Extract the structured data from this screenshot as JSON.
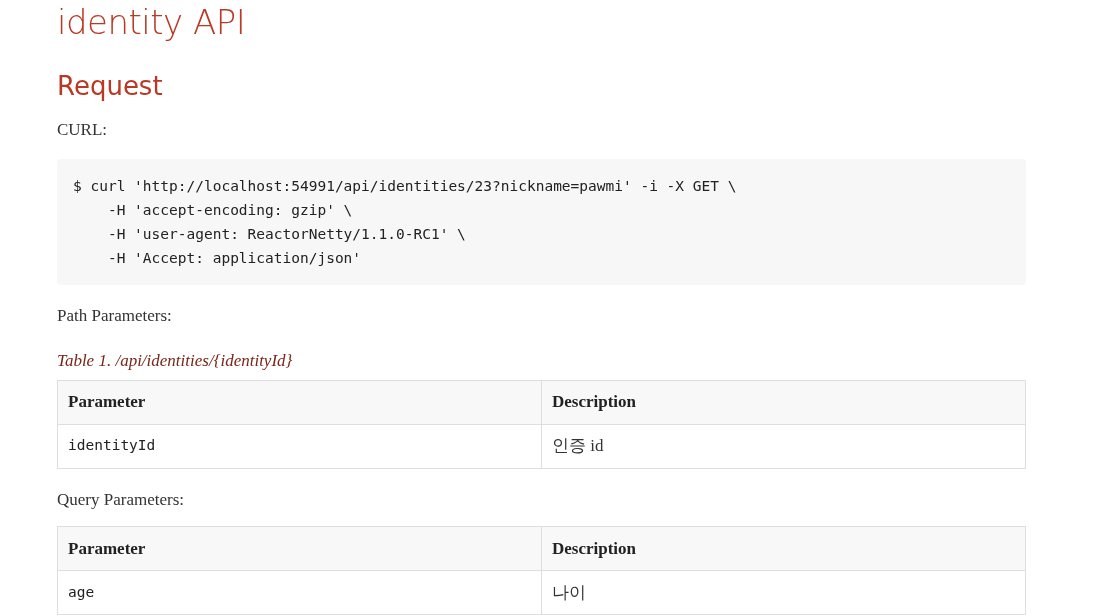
{
  "title": "identity API",
  "section": "Request",
  "curl_label": "CURL:",
  "code_lines": [
    "$ curl 'http://localhost:54991/api/identities/23?nickname=pawmi' -i -X GET \\",
    "    -H 'accept-encoding: gzip' \\",
    "    -H 'user-agent: ReactorNetty/1.1.0-RC1' \\",
    "    -H 'Accept: application/json'"
  ],
  "blocks": [
    {
      "label": "Path Parameters:",
      "caption": "Table 1. /api/identities/{identityId}",
      "columns": [
        "Parameter",
        "Description"
      ],
      "rows": [
        [
          "identityId",
          "인증 id"
        ]
      ]
    },
    {
      "label": "Query Parameters:",
      "columns": [
        "Parameter",
        "Description"
      ],
      "rows": [
        [
          "age",
          "나이"
        ]
      ]
    }
  ]
}
